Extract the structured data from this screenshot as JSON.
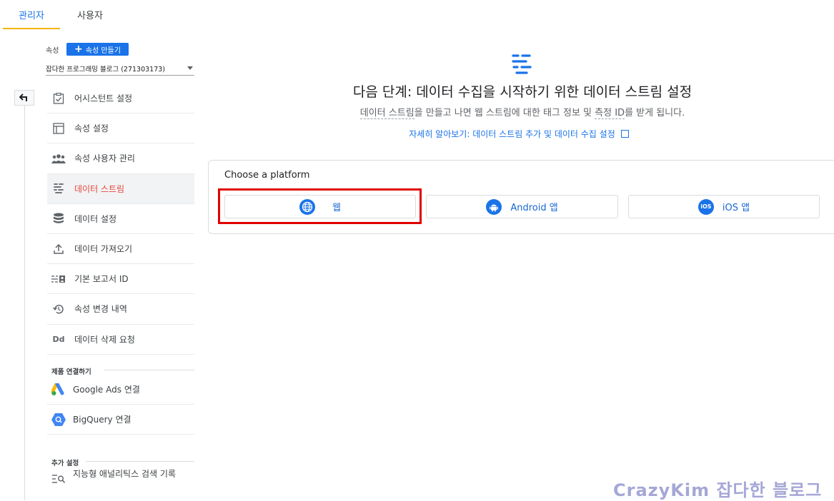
{
  "tabs": {
    "admin": "관리자",
    "user": "사용자"
  },
  "property": {
    "label": "속성",
    "create_button": "속성 만들기",
    "selected": "잡다한 프로그래밍 블로그 (271303173)"
  },
  "nav": [
    {
      "label": "어시스턴트 설정",
      "icon": "checklist-icon"
    },
    {
      "label": "속성 설정",
      "icon": "layout-icon"
    },
    {
      "label": "속성 사용자 관리",
      "icon": "people-icon"
    },
    {
      "label": "데이터 스트림",
      "icon": "streams-icon",
      "active": true
    },
    {
      "label": "데이터 설정",
      "icon": "database-icon"
    },
    {
      "label": "데이터 가져오기",
      "icon": "upload-icon"
    },
    {
      "label": "기본 보고서 ID",
      "icon": "id-card-icon"
    },
    {
      "label": "속성 변경 내역",
      "icon": "history-icon"
    },
    {
      "label": "데이터 삭제 요청",
      "icon": "dd-icon"
    }
  ],
  "product_links": {
    "heading": "제품 연결하기",
    "items": [
      {
        "label": "Google Ads 연결",
        "icon": "google-ads-icon"
      },
      {
        "label": "BigQuery 연결",
        "icon": "bigquery-icon"
      }
    ]
  },
  "additional": {
    "heading": "추가 설정",
    "items": [
      {
        "label": "지능형 애널리틱스 검색 기록",
        "icon": "search-list-icon"
      }
    ]
  },
  "main": {
    "title": "다음 단계: 데이터 수집을 시작하기 위한 데이터 스트림 설정",
    "sub_part1": "데이터 스트림",
    "sub_part2": "을 만들고 나면 웹 스트림에 대한 태그 정보 및 ",
    "sub_part3": "측정 ID",
    "sub_part4": "를 받게 됩니다.",
    "learn_more": "자세히 알아보기: 데이터 스트림 추가 및 데이터 수집 설정"
  },
  "platform": {
    "heading": "Choose a platform",
    "web": "웹",
    "android": "Android 앱",
    "ios": "iOS 앱",
    "ios_badge": "iOS"
  },
  "watermark": "CrazyKim 잡다한 블로그",
  "colors": {
    "accent": "#1a73e8",
    "active": "#e8453c",
    "highlight": "#e00000"
  }
}
